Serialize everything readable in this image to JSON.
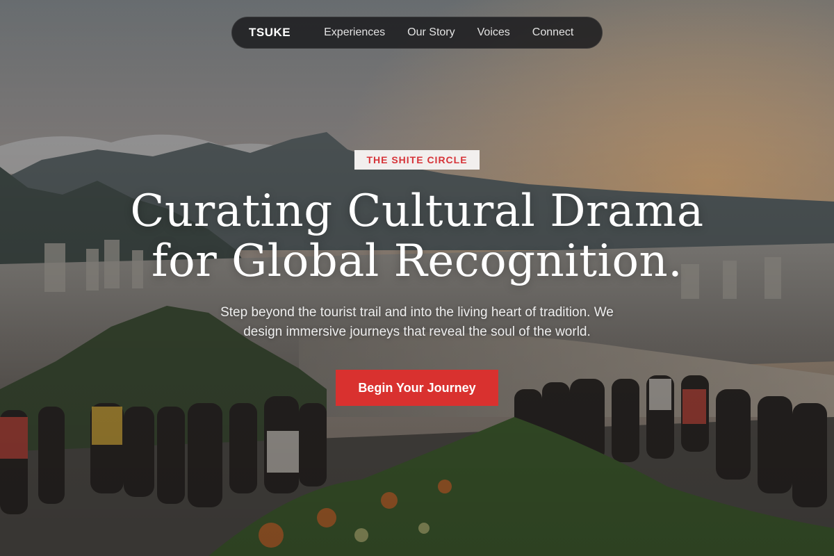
{
  "nav": {
    "brand": "TSUKE",
    "links": [
      "Experiences",
      "Our Story",
      "Voices",
      "Connect"
    ]
  },
  "hero": {
    "badge": "THE SHITE CIRCLE",
    "headline_line1": "Curating Cultural Drama",
    "headline_line2": "for Global Recognition.",
    "subtitle_line1": "Step beyond the tourist trail and into the living heart of tradition. We",
    "subtitle_line2": "design immersive journeys that reveal the soul of the world.",
    "cta_label": "Begin Your Journey"
  },
  "colors": {
    "accent": "#d9312f",
    "badge_text": "#d63338",
    "nav_bg": "#1c1c1e",
    "text": "#ffffff"
  }
}
